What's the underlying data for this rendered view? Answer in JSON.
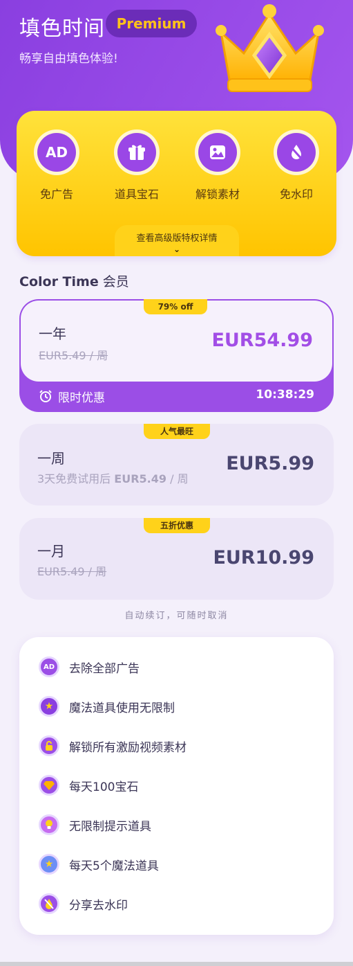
{
  "header": {
    "title": "填色时间",
    "premium_badge": "Premium",
    "subtitle": "畅享自由填色体验!"
  },
  "benefits": [
    {
      "label": "免广告",
      "icon": "ad-icon"
    },
    {
      "label": "道具宝石",
      "icon": "gift-icon"
    },
    {
      "label": "解锁素材",
      "icon": "image-icon"
    },
    {
      "label": "免水印",
      "icon": "no-watermark-icon"
    }
  ],
  "details_link": "查看高级版特权详情",
  "section": {
    "brand": "Color Time",
    "suffix": "会员"
  },
  "plans": [
    {
      "badge": "79% off",
      "name": "一年",
      "sub_strike": "EUR5.49 / 周",
      "price": "EUR54.99",
      "countdown_label": "限时优惠",
      "countdown_time": "10:38:29"
    },
    {
      "badge": "人气最旺",
      "name": "一周",
      "sub_prefix": "3天免费试用后 ",
      "sub_price": "EUR5.49",
      "sub_suffix": " / 周",
      "price": "EUR5.99"
    },
    {
      "badge": "五折优惠",
      "name": "一月",
      "sub_strike": "EUR5.49 / 周",
      "price": "EUR10.99"
    }
  ],
  "renew_note": "自动续订，可随时取消",
  "features": [
    {
      "text": "去除全部广告",
      "icon": "ad-icon"
    },
    {
      "text": "魔法道具使用无限制",
      "icon": "star-icon"
    },
    {
      "text": "解锁所有激励视频素材",
      "icon": "unlock-icon"
    },
    {
      "text": "每天100宝石",
      "icon": "gem-icon"
    },
    {
      "text": "无限制提示道具",
      "icon": "bulb-icon"
    },
    {
      "text": "每天5个魔法道具",
      "icon": "magic-icon"
    },
    {
      "text": "分享去水印",
      "icon": "no-watermark-icon"
    }
  ],
  "colors": {
    "primary": "#9b4ee6",
    "accent_yellow": "#ffd21a",
    "background": "#f4f0fb"
  }
}
